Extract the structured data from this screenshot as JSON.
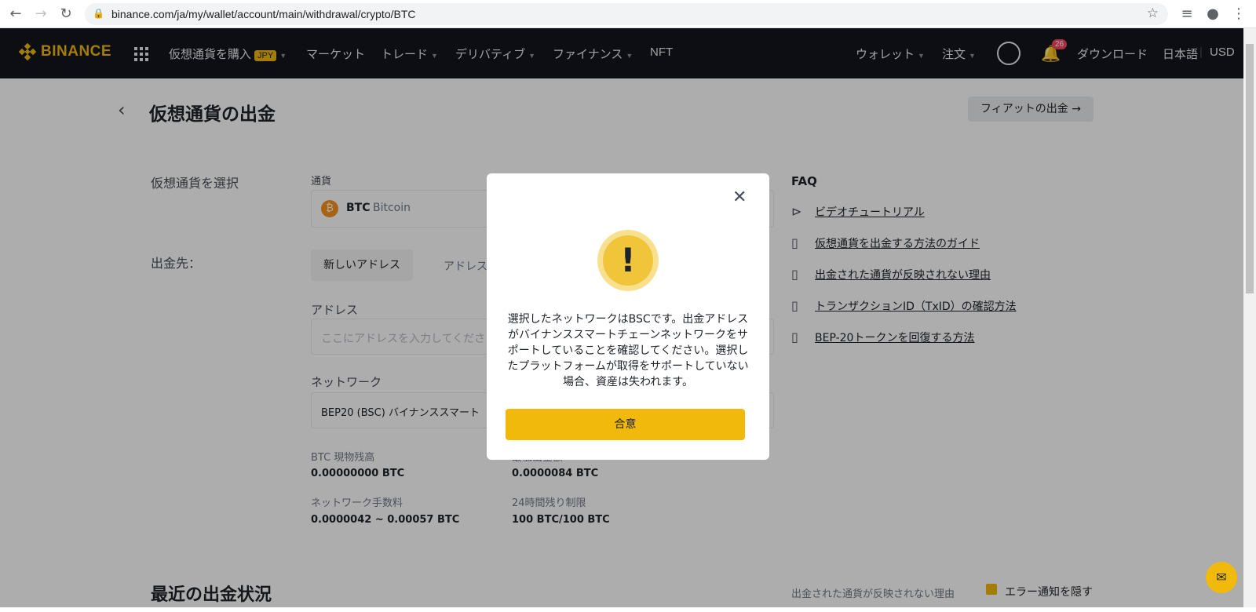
{
  "browser": {
    "url": "binance.com/ja/my/wallet/account/main/withdrawal/crypto/BTC"
  },
  "nav": {
    "brand": "BINANCE",
    "buy_crypto": "仮想通貨を購入",
    "jpy_badge": "JPY",
    "market": "マーケット",
    "trade": "トレード",
    "derivatives": "デリバティブ",
    "finance": "ファイナンス",
    "nft": "NFT",
    "wallet": "ウォレット",
    "orders": "注文",
    "notif_count": "26",
    "download": "ダウンロード",
    "language": "日本語",
    "separator": "|",
    "currency": "USD"
  },
  "page": {
    "title": "仮想通貨の出金",
    "fiat_withdraw": "フィアットの出金 →",
    "select_crypto_label": "仮想通貨を選択",
    "currency_label": "通貨",
    "coin_symbol": "BTC",
    "coin_name": "Bitcoin",
    "withdraw_to_label": "出金先：",
    "tab_new_address": "新しいアドレス",
    "tab_address_book": "アドレス",
    "address_label": "アドレス",
    "address_placeholder": "ここにアドレスを入力してくださ",
    "network_label": "ネットワーク",
    "network_value": "BEP20 (BSC) バイナンススマート",
    "spot_balance_label": "BTC 現物残高",
    "spot_balance": "0.00000000 BTC",
    "min_withdraw_label": "最低出金額",
    "min_withdraw": "0.0000084 BTC",
    "network_fee_label": "ネットワーク手数料",
    "network_fee": "0.0000042 ~ 0.00057 BTC",
    "limit_label": "24時間残り制限",
    "limit": "100 BTC/100 BTC",
    "recent_title": "最近の出金状況",
    "bottom_faq": "出金された通貨が反映されない理由",
    "error_notify": "エラー通知を隠す"
  },
  "faq": {
    "title": "FAQ",
    "items": [
      "ビデオチュートリアル",
      "仮想通貨を出金する方法のガイド",
      "出金された通貨が反映されない理由",
      "トランザクションID（TxID）の確認方法",
      "BEP-20トークンを回復する方法"
    ]
  },
  "modal": {
    "message": "選択したネットワークはBSCです。出金アドレスがバイナンススマートチェーンネットワークをサポートしていることを確認してください。選択したプラットフォームが取得をサポートしていない場合、資産は失われます。",
    "agree": "合意",
    "warn_symbol": "!"
  },
  "colors": {
    "accent": "#f0b90b",
    "nav_bg": "#12161c"
  }
}
